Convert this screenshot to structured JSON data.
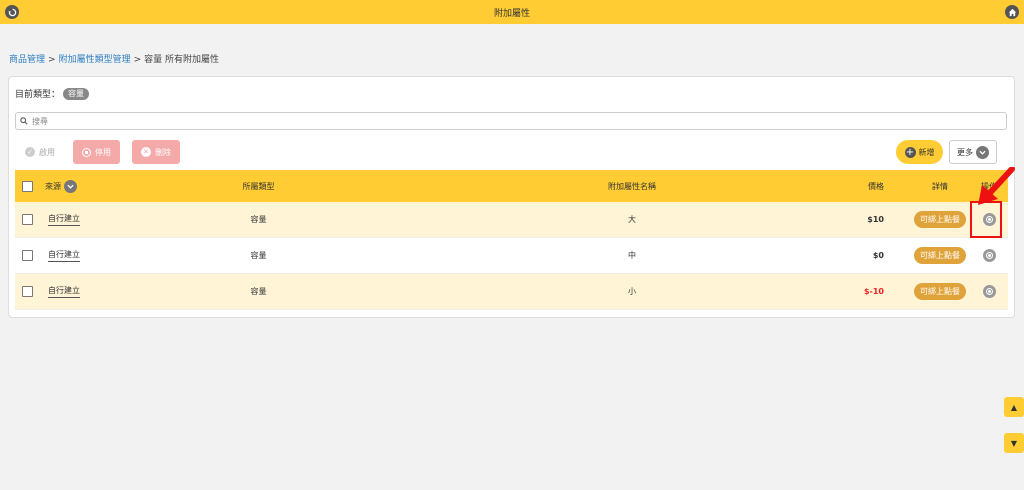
{
  "header": {
    "title": "附加屬性",
    "back_icon": "back-icon",
    "home_icon": "home-icon"
  },
  "breadcrumb": {
    "items": [
      "商品管理",
      "附加屬性類型管理",
      "容量 所有附加屬性"
    ],
    "separator": ">"
  },
  "current_type": {
    "label": "目前類型：",
    "value": "容量"
  },
  "search": {
    "placeholder": "搜尋"
  },
  "actions": {
    "enable_label": "啟用",
    "disable_label": "停用",
    "delete_label": "刪除",
    "add_label": "新增",
    "more_label": "更多"
  },
  "table": {
    "columns": {
      "source": "來源",
      "type": "所屬類型",
      "name": "附加屬性名稱",
      "price": "價格",
      "detail": "詳情",
      "operation": "操作"
    },
    "rows": [
      {
        "source": "自行建立",
        "type": "容量",
        "name": "大",
        "price": "$10",
        "detail": "可綁上點餐"
      },
      {
        "source": "自行建立",
        "type": "容量",
        "name": "中",
        "price": "$0",
        "detail": "可綁上點餐"
      },
      {
        "source": "自行建立",
        "type": "容量",
        "name": "小",
        "price": "$-10",
        "detail": "可綁上點餐"
      }
    ]
  },
  "scroll": {
    "up": "▲",
    "down": "▼"
  },
  "colors": {
    "accent": "#ffcc33",
    "danger_soft": "#f3aaa9",
    "detail_button": "#e0a33a",
    "negative_price": "#e22222",
    "link": "#2d7fc1"
  }
}
